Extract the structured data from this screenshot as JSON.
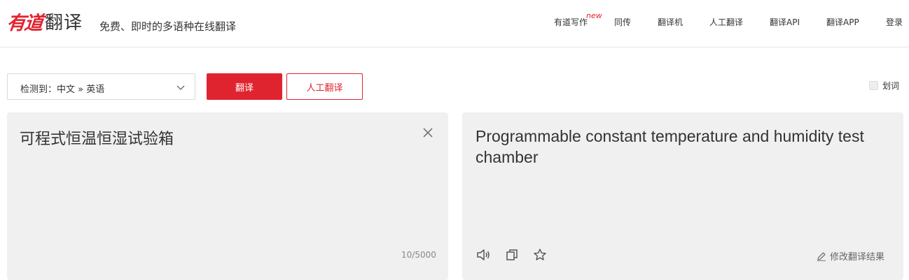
{
  "header": {
    "logo_mark": "有道",
    "logo_text": "翻译",
    "slogan": "免费、即时的多语种在线翻译",
    "nav": [
      {
        "label": "有道写作",
        "badge": "new"
      },
      {
        "label": "同传"
      },
      {
        "label": "翻译机"
      },
      {
        "label": "人工翻译"
      },
      {
        "label": "翻译API"
      },
      {
        "label": "翻译APP"
      },
      {
        "label": "登录"
      }
    ]
  },
  "toolbar": {
    "lang_select": "检测到：中文 » 英语",
    "translate_button": "翻译",
    "human_translate_button": "人工翻译",
    "huaci_label": "划词"
  },
  "source": {
    "text": "可程式恒温恒湿试验箱",
    "char_count": "10/5000"
  },
  "target": {
    "text": "Programmable constant temperature and humidity test chamber",
    "edit_label": "修改翻译结果"
  },
  "colors": {
    "brand_red": "#e0242f",
    "panel_bg": "#f0f0f0"
  },
  "icons": [
    "chevron-down-icon",
    "close-icon",
    "speaker-icon",
    "copy-icon",
    "star-icon",
    "pencil-icon"
  ]
}
